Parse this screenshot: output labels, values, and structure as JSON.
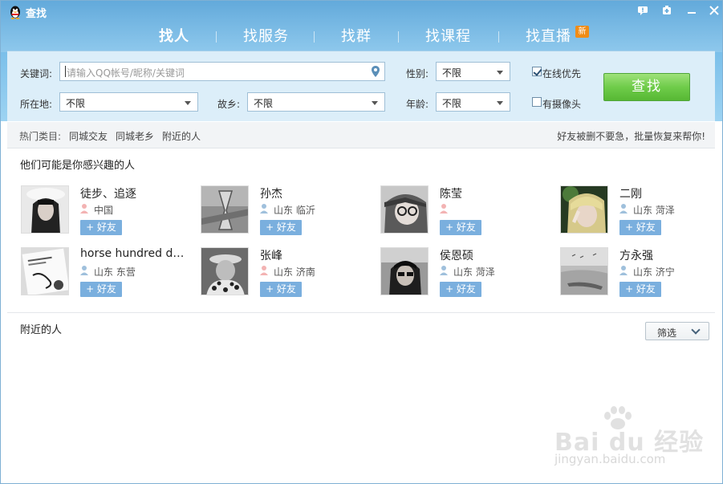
{
  "window": {
    "title": "查找"
  },
  "tabs": [
    {
      "label": "找人",
      "active": true
    },
    {
      "label": "找服务",
      "active": false
    },
    {
      "label": "找群",
      "active": false
    },
    {
      "label": "找课程",
      "active": false
    },
    {
      "label": "找直播",
      "active": false,
      "badge": "新"
    }
  ],
  "search": {
    "keyword_label": "关键词:",
    "keyword_placeholder": "请输入QQ帐号/昵称/关键词",
    "gender_label": "性别:",
    "gender_value": "不限",
    "location_label": "所在地:",
    "location_value": "不限",
    "hometown_label": "故乡:",
    "hometown_value": "不限",
    "age_label": "年龄:",
    "age_value": "不限",
    "online_first_label": "在线优先",
    "online_first_checked": true,
    "has_camera_label": "有摄像头",
    "has_camera_checked": false,
    "find_button": "查找"
  },
  "hot": {
    "label": "热门类目:",
    "links": [
      "同城交友",
      "同城老乡",
      "附近的人"
    ],
    "right_text": "好友被删不要急，批量恢复来帮你!"
  },
  "suggest": {
    "title": "他们可能是你感兴趣的人",
    "add_label": "+ 好友",
    "people": [
      {
        "name": "徒步、追逐",
        "location": "中国",
        "gender": "female"
      },
      {
        "name": "孙杰",
        "location": "山东 临沂",
        "gender": "male"
      },
      {
        "name": "陈莹",
        "location": "",
        "gender": "female"
      },
      {
        "name": "二刚",
        "location": "山东 菏泽",
        "gender": "male"
      },
      {
        "name": "horse hundred dr...",
        "location": "山东 东营",
        "gender": "male"
      },
      {
        "name": "张峰",
        "location": "山东 济南",
        "gender": "female"
      },
      {
        "name": "侯恩硕",
        "location": "山东 菏泽",
        "gender": "male"
      },
      {
        "name": "方永强",
        "location": "山东 济宁",
        "gender": "male"
      }
    ]
  },
  "nearby": {
    "title": "附近的人",
    "filter_label": "筛选"
  },
  "watermark": {
    "text": "Bai du 经验",
    "url": "jingyan.baidu.com"
  },
  "colors": {
    "header": "#7cc0ea",
    "find_button": "#6fcc4a",
    "add_button": "#7aafde",
    "new_badge": "#f08c16"
  }
}
